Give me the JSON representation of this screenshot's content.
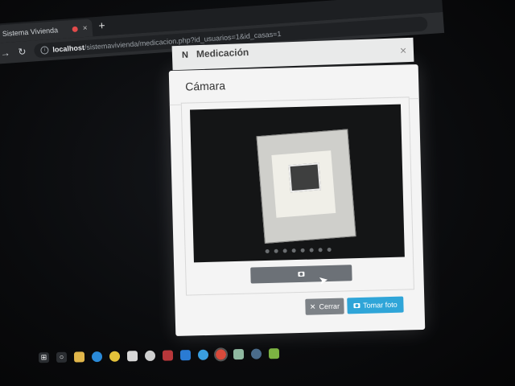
{
  "browser": {
    "tab_title": "Sistema Vivienda",
    "tab_close": "×",
    "new_tab": "+",
    "url_host": "localhost",
    "url_path": "/sistemavivienda/medicacion.php?id_usuarios=1&id_casas=1"
  },
  "background_modal": {
    "title": "Medicación",
    "logo": "N"
  },
  "modal": {
    "title": "Cámara",
    "close_symbol": "×",
    "buttons": {
      "close_label": "Cerrar",
      "take_photo_label": "Tomar foto"
    }
  },
  "icons": {
    "capture": "camera-icon",
    "back": "back-arrow-icon",
    "reload": "reload-icon",
    "cursor": "mouse-cursor-icon"
  },
  "taskbar": {
    "icons": [
      "windows-start",
      "search",
      "file-explorer",
      "edge",
      "chrome",
      "files",
      "app",
      "app-red",
      "vscode",
      "app-blue",
      "chrome-active",
      "notes",
      "app-gear",
      "android"
    ]
  },
  "colors": {
    "primary": "#2fa5d8",
    "secondary": "#7d8287"
  }
}
